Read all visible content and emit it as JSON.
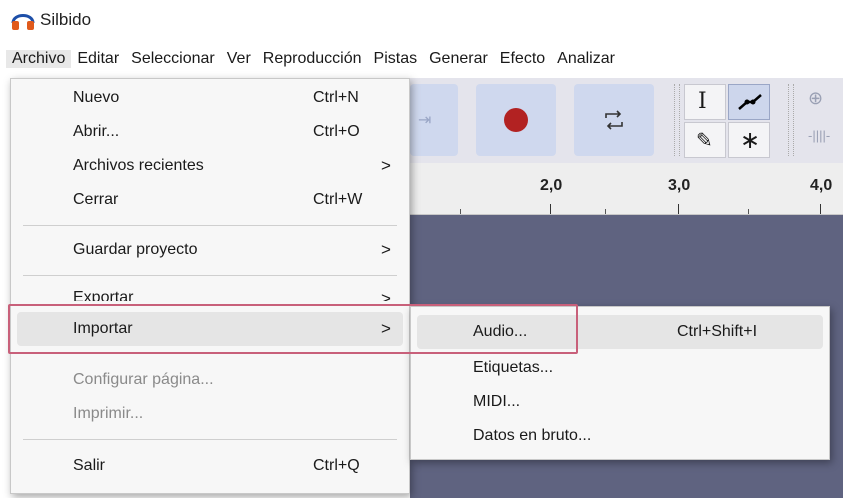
{
  "window": {
    "title": "Silbido",
    "icon": "headphones-icon"
  },
  "menubar": {
    "items": [
      "Archivo",
      "Editar",
      "Seleccionar",
      "Ver",
      "Reproducción",
      "Pistas",
      "Generar",
      "Efecto",
      "Analizar"
    ]
  },
  "file_menu": {
    "items": [
      {
        "label": "Nuevo",
        "shortcut": "Ctrl+N"
      },
      {
        "label": "Abrir...",
        "shortcut": "Ctrl+O"
      },
      {
        "label": "Archivos recientes",
        "arrow": ">"
      },
      {
        "label": "Cerrar",
        "shortcut": "Ctrl+W"
      },
      {
        "label": "Guardar proyecto",
        "arrow": ">"
      },
      {
        "label": "Exportar",
        "arrow": ">"
      },
      {
        "label": "Importar",
        "arrow": ">"
      },
      {
        "label": "Configurar página...",
        "disabled": true
      },
      {
        "label": "Imprimir...",
        "disabled": true
      },
      {
        "label": "Salir",
        "shortcut": "Ctrl+Q"
      }
    ]
  },
  "import_submenu": {
    "items": [
      {
        "label": "Audio...",
        "shortcut": "Ctrl+Shift+I"
      },
      {
        "label": "Etiquetas..."
      },
      {
        "label": "MIDI..."
      },
      {
        "label": "Datos en bruto..."
      }
    ]
  },
  "ruler": {
    "labels": [
      "2,0",
      "3,0",
      "4,0"
    ]
  },
  "colors": {
    "record": "#b22222",
    "track_bg": "#5f6380",
    "highlight_box": "#c8607a",
    "button_bg": "#cfd8ee"
  }
}
